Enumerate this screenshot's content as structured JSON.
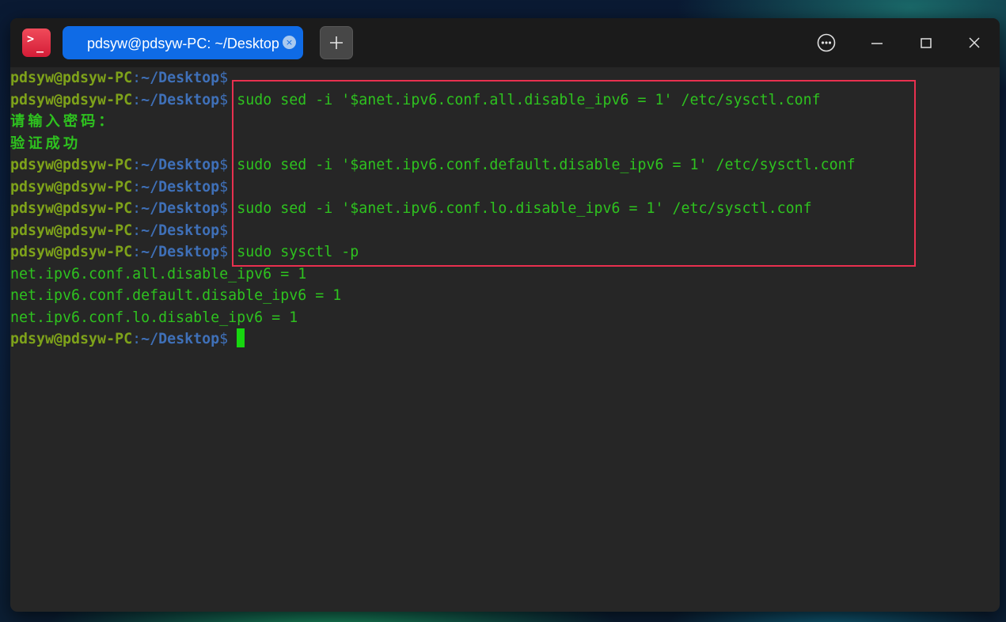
{
  "window": {
    "app_icon": "terminal-icon",
    "tab_title": "pdsyw@pdsyw-PC: ~/Desktop",
    "tab_close_glyph": "×",
    "new_tab_glyph": "+",
    "controls": [
      "more-options-icon",
      "minimize-icon",
      "maximize-icon",
      "close-icon"
    ]
  },
  "terminal": {
    "prompt_user": "pdsyw@pdsyw-PC",
    "prompt_sep": ":",
    "prompt_path": "~/Desktop",
    "prompt_dollar": "$",
    "lines": [
      {
        "type": "prompt",
        "cmd": ""
      },
      {
        "type": "prompt",
        "cmd": " sudo sed -i '$anet.ipv6.conf.all.disable_ipv6 = 1' /etc/sysctl.conf"
      },
      {
        "type": "text",
        "text": "请输入密码：",
        "cjk": true
      },
      {
        "type": "text",
        "text": "验证成功",
        "cjk": true
      },
      {
        "type": "prompt",
        "cmd": " sudo sed -i '$anet.ipv6.conf.default.disable_ipv6 = 1' /etc/sysctl.conf"
      },
      {
        "type": "prompt",
        "cmd": ""
      },
      {
        "type": "prompt",
        "cmd": " sudo sed -i '$anet.ipv6.conf.lo.disable_ipv6 = 1' /etc/sysctl.conf"
      },
      {
        "type": "prompt",
        "cmd": ""
      },
      {
        "type": "prompt",
        "cmd": " sudo sysctl -p"
      },
      {
        "type": "text",
        "text": "net.ipv6.conf.all.disable_ipv6 = 1"
      },
      {
        "type": "text",
        "text": "net.ipv6.conf.default.disable_ipv6 = 1"
      },
      {
        "type": "text",
        "text": "net.ipv6.conf.lo.disable_ipv6 = 1"
      },
      {
        "type": "prompt",
        "cmd": " ",
        "cursor": true
      }
    ]
  },
  "colors": {
    "prompt_user": "#7ea21a",
    "prompt_path": "#3f70b8",
    "output": "#2ec21f",
    "highlight_border": "#e8304f",
    "tab_active": "#0f6be6"
  }
}
